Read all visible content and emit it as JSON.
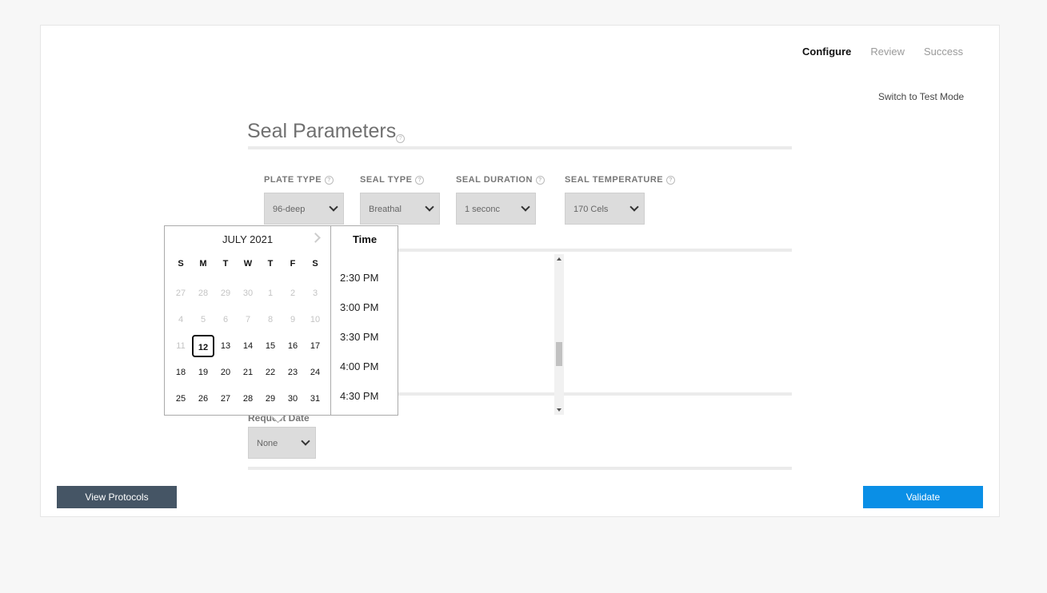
{
  "steps": [
    {
      "label": "Configure",
      "active": true
    },
    {
      "label": "Review",
      "active": false
    },
    {
      "label": "Success",
      "active": false
    }
  ],
  "test_mode_link": "Switch to Test Mode",
  "section_title": "Seal Parameters",
  "help_glyph": "?",
  "fields": {
    "plate_type": {
      "label": "PLATE TYPE",
      "value": "96-deep"
    },
    "seal_type": {
      "label": "SEAL TYPE",
      "value": "Breathal"
    },
    "seal_duration": {
      "label": "SEAL DURATION",
      "value": "1 seconc"
    },
    "seal_temperature": {
      "label": "SEAL TEMPERATURE",
      "value": "170 Cels"
    }
  },
  "request_date": {
    "label": "Request Date",
    "value": "None"
  },
  "buttons": {
    "view_protocols": "View Protocols",
    "validate": "Validate"
  },
  "datepicker": {
    "month_label": "JULY 2021",
    "weekdays": [
      "S",
      "M",
      "T",
      "W",
      "T",
      "F",
      "S"
    ],
    "weeks": [
      [
        "27",
        "28",
        "29",
        "30",
        "1",
        "2",
        "3"
      ],
      [
        "4",
        "5",
        "6",
        "7",
        "8",
        "9",
        "10"
      ],
      [
        "11",
        "12",
        "13",
        "14",
        "15",
        "16",
        "17"
      ],
      [
        "18",
        "19",
        "20",
        "21",
        "22",
        "23",
        "24"
      ],
      [
        "25",
        "26",
        "27",
        "28",
        "29",
        "30",
        "31"
      ]
    ],
    "muted_days": [
      "0-0",
      "0-1",
      "0-2",
      "0-3",
      "0-4",
      "0-5",
      "0-6",
      "1-0",
      "1-1",
      "1-2",
      "1-3",
      "1-4",
      "1-5",
      "1-6",
      "2-0"
    ],
    "selected_day": "12",
    "time_header": "Time",
    "times": [
      "2:30 PM",
      "3:00 PM",
      "3:30 PM",
      "4:00 PM",
      "4:30 PM"
    ]
  },
  "colors": {
    "primary": "#0a8fe6",
    "dark_button": "#455565",
    "select_bg": "#dcdcdc"
  }
}
